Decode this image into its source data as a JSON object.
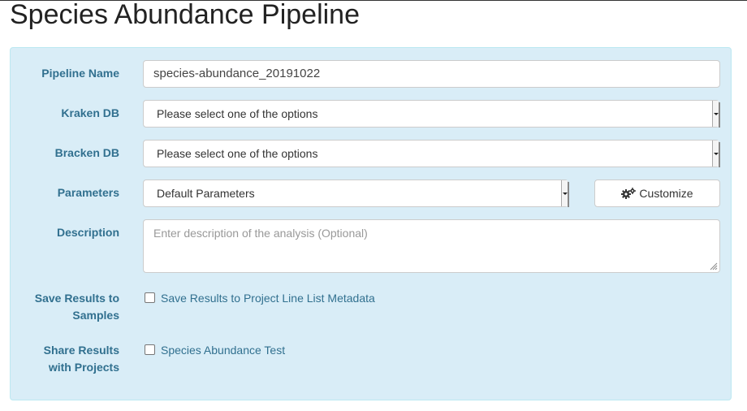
{
  "page": {
    "title": "Species Abundance Pipeline"
  },
  "form": {
    "pipeline_name": {
      "label": "Pipeline Name",
      "value": "species-abundance_20191022"
    },
    "kraken_db": {
      "label": "Kraken DB",
      "selected": "Please select one of the options"
    },
    "bracken_db": {
      "label": "Bracken DB",
      "selected": "Please select one of the options"
    },
    "parameters": {
      "label": "Parameters",
      "selected": "Default Parameters",
      "customize_label": "Customize",
      "customize_icon": "gears-icon"
    },
    "description": {
      "label": "Description",
      "placeholder": "Enter description of the analysis (Optional)"
    },
    "save_results": {
      "label_line1": "Save Results to",
      "label_line2": "Samples",
      "option_label": "Save Results to Project Line List Metadata",
      "checked": false
    },
    "share_results": {
      "label_line1": "Share Results",
      "label_line2": "with Projects",
      "option_label": "Species Abundance Test",
      "checked": false
    }
  },
  "colors": {
    "panel_bg": "#d9edf7",
    "panel_border": "#bce8f1",
    "label_text": "#31708f"
  }
}
